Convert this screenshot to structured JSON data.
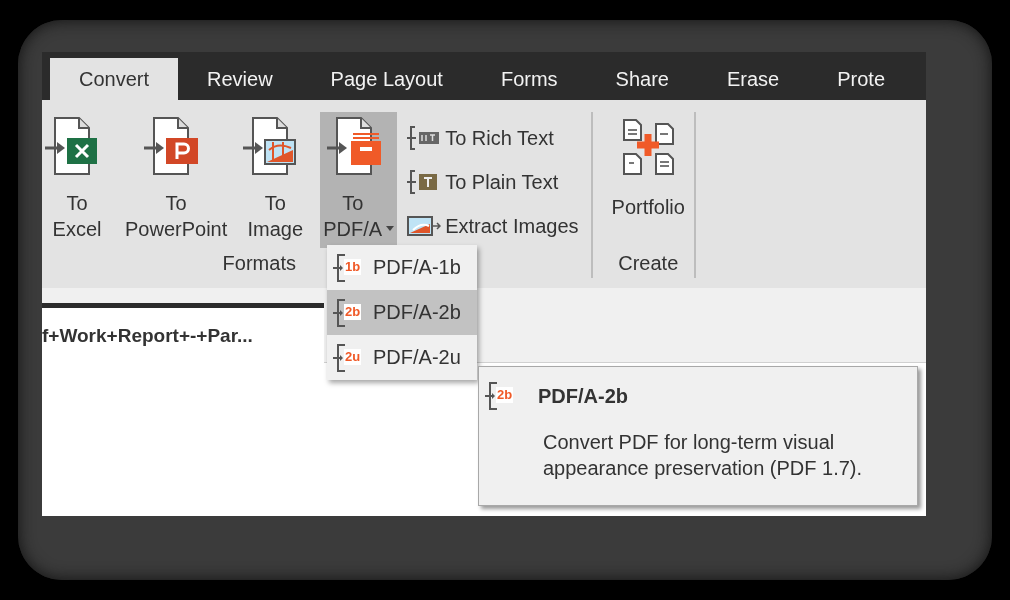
{
  "tabs": [
    {
      "label": "Convert",
      "selected": true
    },
    {
      "label": "Review",
      "selected": false
    },
    {
      "label": "Page Layout",
      "selected": false
    },
    {
      "label": "Forms",
      "selected": false
    },
    {
      "label": "Share",
      "selected": false
    },
    {
      "label": "Erase",
      "selected": false
    },
    {
      "label": "Prote",
      "selected": false
    }
  ],
  "ribbon": {
    "groups": [
      {
        "label": "Formats",
        "buttons": [
          {
            "kind": "large",
            "label": "To Excel",
            "selected": false
          },
          {
            "kind": "large",
            "label": "To PowerPoint",
            "selected": false
          },
          {
            "kind": "large",
            "label": "To Image",
            "selected": false
          },
          {
            "kind": "large-menu",
            "label": "To PDF/A",
            "selected": true
          },
          {
            "kind": "small",
            "label": "To Rich Text"
          },
          {
            "kind": "small",
            "label": "To Plain Text"
          },
          {
            "kind": "small",
            "label": "Extract Images"
          }
        ]
      },
      {
        "label": "Create",
        "buttons": [
          {
            "kind": "large",
            "label": "Portfolio",
            "selected": false
          }
        ]
      }
    ]
  },
  "document_tab": {
    "title": "f+Work+Report+-+Par..."
  },
  "dropdown_menu": {
    "items": [
      {
        "badge": "1b",
        "label": "PDF/A-1b",
        "selected": false
      },
      {
        "badge": "2b",
        "label": "PDF/A-2b",
        "selected": true
      },
      {
        "badge": "2u",
        "label": "PDF/A-2u",
        "selected": false
      }
    ]
  },
  "tooltip": {
    "badge": "2b",
    "title": "PDF/A-2b",
    "description": "Convert PDF for long-term visual appearance preservation (PDF 1.7)."
  }
}
